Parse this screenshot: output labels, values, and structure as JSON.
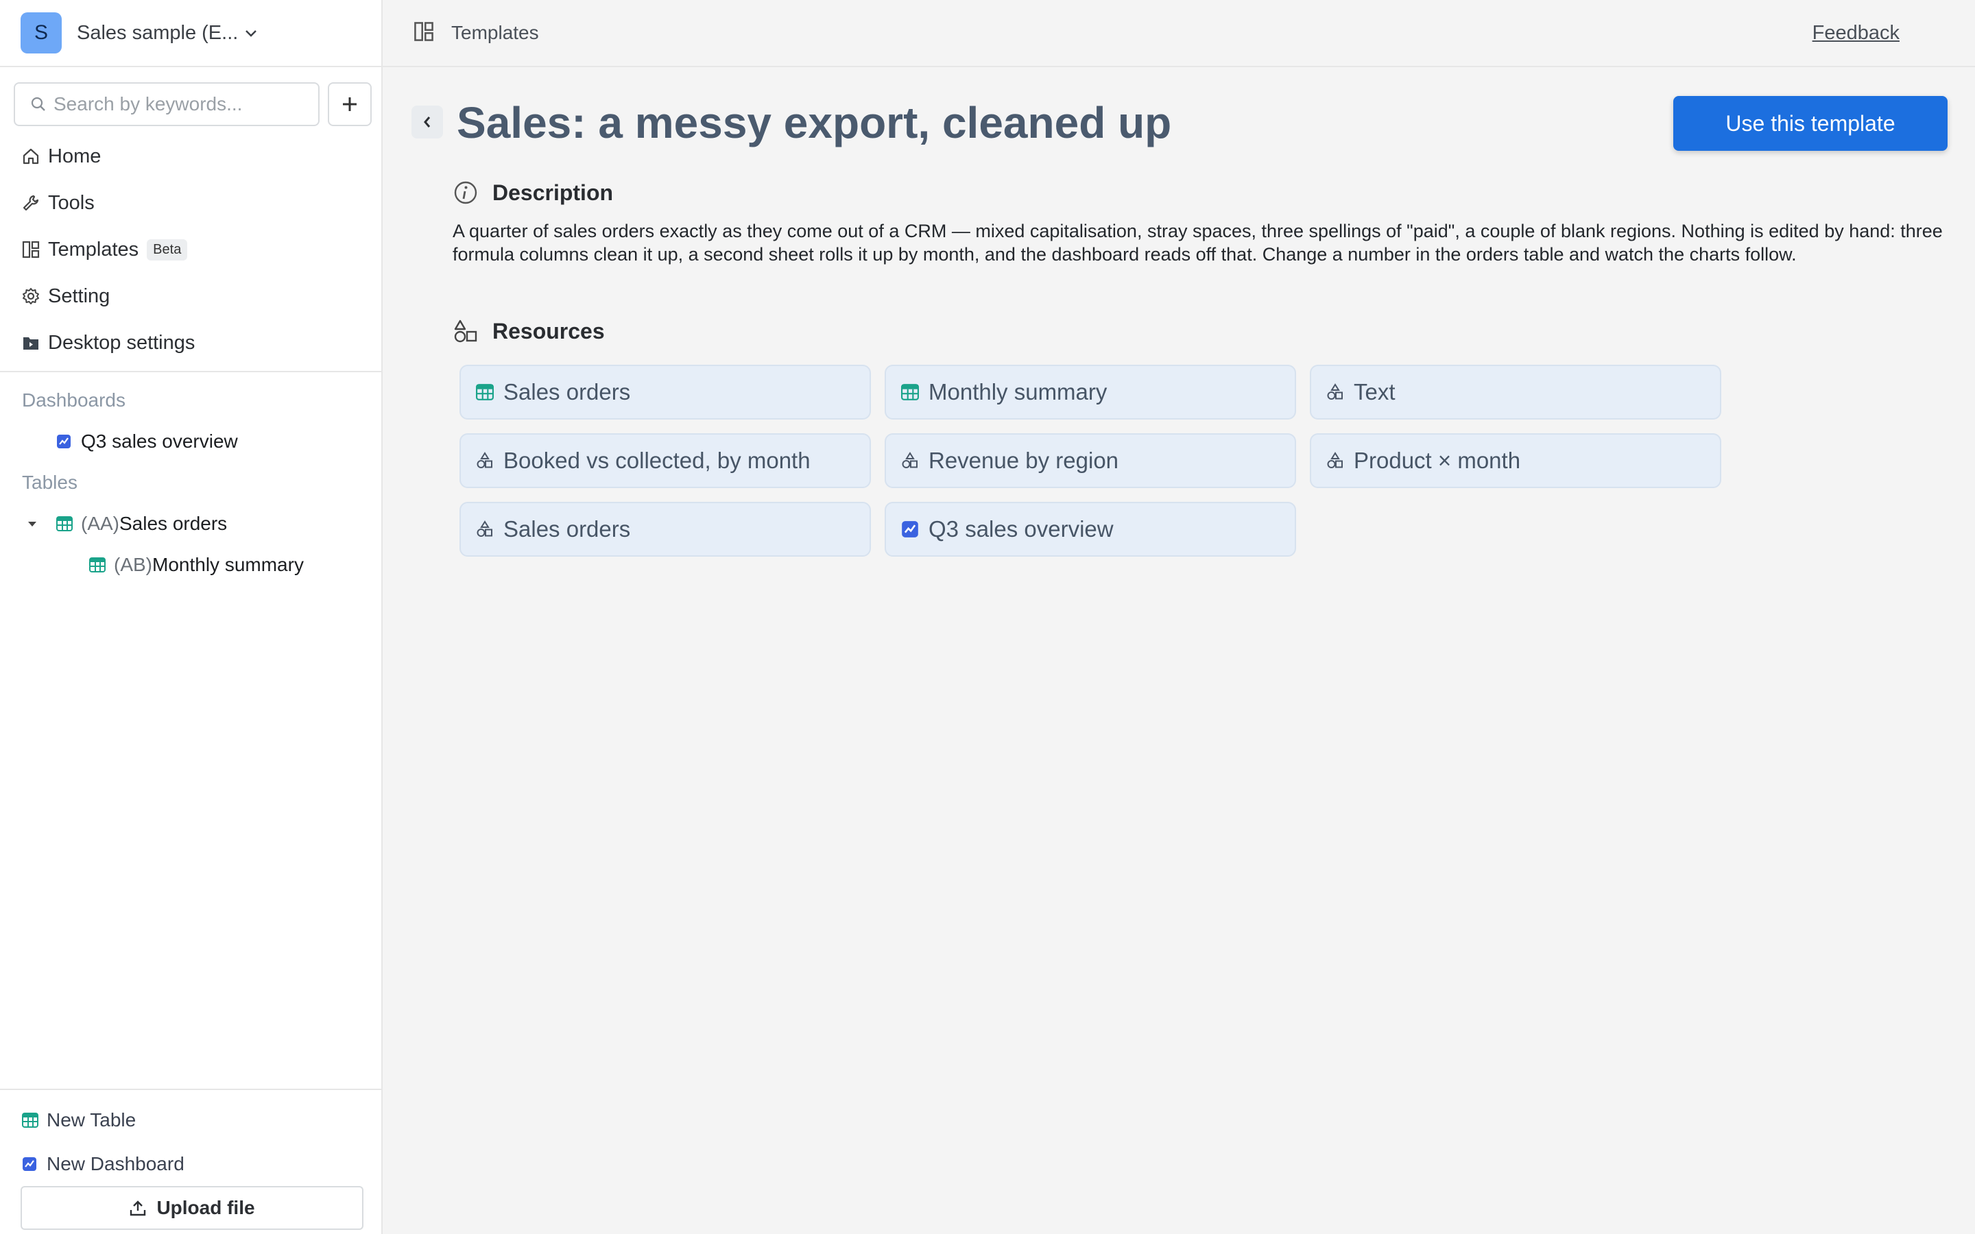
{
  "workspace": {
    "avatar_letter": "S",
    "name": "Sales sample (E..."
  },
  "search": {
    "placeholder": "Search by keywords..."
  },
  "nav": {
    "home": "Home",
    "tools": "Tools",
    "templates": "Templates",
    "templates_badge": "Beta",
    "setting": "Setting",
    "desktop_settings": "Desktop settings"
  },
  "sections": {
    "dashboards": "Dashboards",
    "tables": "Tables"
  },
  "dashboards": [
    {
      "label": "Q3 sales overview"
    }
  ],
  "tables": [
    {
      "prefix": "(AA)",
      "label": "Sales orders"
    },
    {
      "prefix": "(AB)",
      "label": "Monthly summary"
    }
  ],
  "sidebar_bottom": {
    "new_table": "New Table",
    "new_dashboard": "New Dashboard",
    "upload": "Upload file"
  },
  "topbar": {
    "breadcrumb": "Templates",
    "feedback": "Feedback"
  },
  "template": {
    "title": "Sales: a messy export, cleaned up",
    "use_button": "Use this template",
    "description_heading": "Description",
    "description": "A quarter of sales orders exactly as they come out of a CRM — mixed capitalisation, stray spaces, three spellings of \"paid\", a couple of blank regions. Nothing is edited by hand: three formula columns clean it up, a second sheet rolls it up by month, and the dashboard reads off that. Change a number in the orders table and watch the charts follow.",
    "resources_heading": "Resources",
    "resources": [
      {
        "label": "Sales orders",
        "icon": "table-icon"
      },
      {
        "label": "Monthly summary",
        "icon": "table-icon"
      },
      {
        "label": "Text",
        "icon": "widget-icon"
      },
      {
        "label": "Booked vs collected, by month",
        "icon": "widget-icon"
      },
      {
        "label": "Revenue by region",
        "icon": "widget-icon"
      },
      {
        "label": "Product × month",
        "icon": "widget-icon"
      },
      {
        "label": "Sales orders",
        "icon": "widget-icon"
      },
      {
        "label": "Q3 sales overview",
        "icon": "dashboard-icon"
      }
    ]
  },
  "colors": {
    "accent": "#1c6fdf",
    "table_icon": "#1aa38a",
    "dashboard_icon": "#3a62e0",
    "card_bg": "#e6eef8"
  }
}
